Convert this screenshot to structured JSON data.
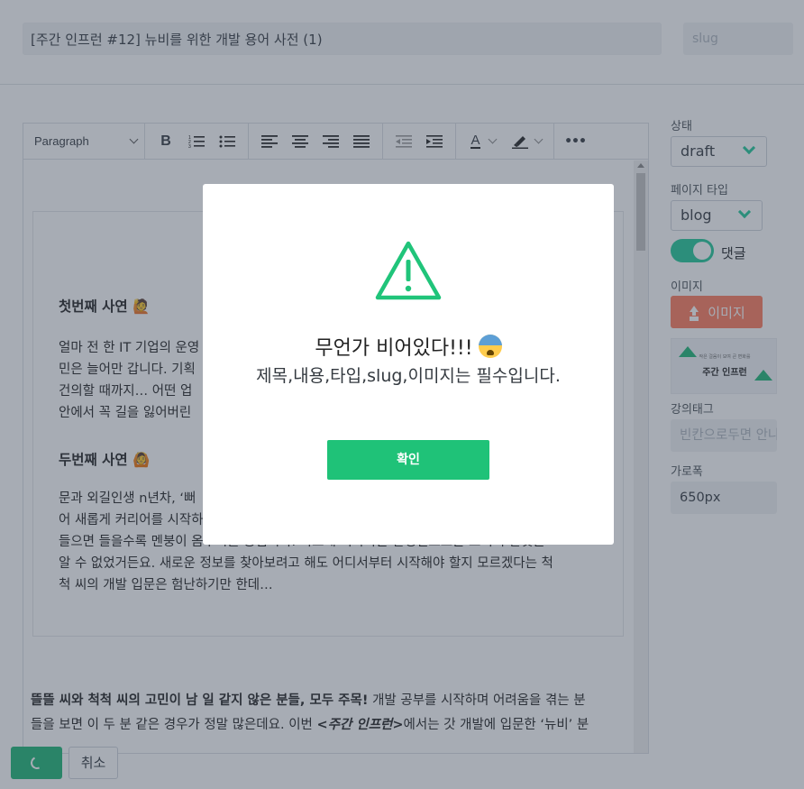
{
  "post": {
    "title": "[주간 인프런 #12] 뉴비를 위한 개발 용어 사전 (1)",
    "slug_placeholder": "slug"
  },
  "toolbar": {
    "block_format": "Paragraph",
    "bold": "B",
    "text_color": "A",
    "more": "•••"
  },
  "content": {
    "case1_title": "첫번째 사연 🙋",
    "case1_text_lines": [
      "얼마 전 한 IT 기업의 운영",
      "민은 늘어만 갑니다. 기획",
      "건의할 때까지… 어떤 업",
      "안에서 꼭 길을 잃어버린"
    ],
    "case2_title": "두번째 사연 🙆",
    "case2_text_lines": [
      "문과 외길인생 n년차, ‘뻐",
      "어 새롭게 커리어를 시작하",
      "들으면 들을수록 멘붕이 옴주시를 쁭됩니다. 빠르게 치나가는 할성인으로는 도서히 할것을",
      "알 수 없었거든요. 새로운 정보를 찾아보려고 해도 어디서부터 시작해야 할지 모르겠다는 척",
      "척 씨의 개발 입문은 험난하기만 한데…"
    ],
    "outro_bold": "뜰뜰 씨와 척척 씨의 고민이 남 일 같지 않은 분들, 모두 주목!",
    "outro_text_1": " 개발 공부를 시작하며 어려움을 겪는 분",
    "outro_text_2": "들을 보면 이 두 분 같은 경우가 정말 많은데요. 이번 ",
    "outro_italic": "<주간 인프런>",
    "outro_text_3": "에서는 갓 개발에 입문한 ‘뉴비’ 분"
  },
  "sidebar": {
    "status_label": "상태",
    "status_value": "draft",
    "page_type_label": "페이지 타입",
    "page_type_value": "blog",
    "comments_label": "댓글",
    "comments_enabled": true,
    "image_label": "이미지",
    "image_button": "이미지",
    "thumbnail_small": "작은 걸음이 모여 큰 변화를",
    "thumbnail_title": "주간 인프런",
    "course_tag_label": "강의태그",
    "course_tag_placeholder": "빈칸으로두면 안나",
    "width_label": "가로폭",
    "width_value": "650px"
  },
  "actions": {
    "cancel_label": "취소"
  },
  "modal": {
    "title": "무언가 비어있다!!!",
    "message": "제목,내용,타입,slug,이미지는 필수입니다.",
    "confirm_label": "확인"
  },
  "colors": {
    "accent_green": "#1fc278",
    "image_button": "#ff7b5b",
    "warning_icon": "#20c47a"
  }
}
